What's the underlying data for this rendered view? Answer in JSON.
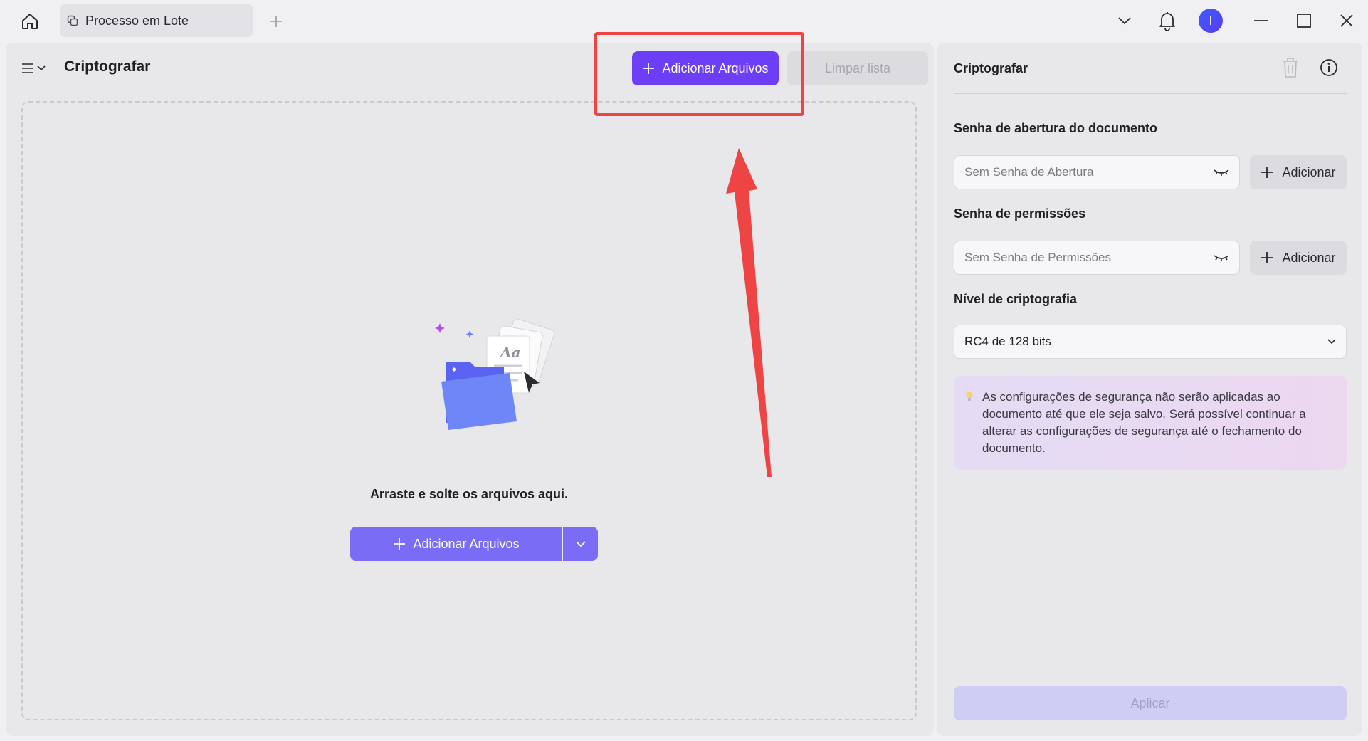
{
  "titlebar": {
    "tab_label": "Processo em Lote",
    "avatar_initial": "I"
  },
  "left": {
    "title": "Criptografar",
    "add_files_label": "Adicionar Arquivos",
    "clear_list_label": "Limpar lista",
    "drop_text": "Arraste e solte os arquivos aqui.",
    "drop_add_files_label": "Adicionar Arquivos"
  },
  "right": {
    "title": "Criptografar",
    "open_password_section": "Senha de abertura do documento",
    "open_password_placeholder": "Sem Senha de Abertura",
    "open_password_add": "Adicionar",
    "permissions_section": "Senha de permissões",
    "permissions_placeholder": "Sem Senha de Permissões",
    "permissions_add": "Adicionar",
    "level_section": "Nível de criptografia",
    "level_value": "RC4 de 128 bits",
    "notice": "As configurações de segurança não serão aplicadas ao documento até que ele seja salvo. Será possível continuar a alterar as configurações de segurança até o fechamento do documento.",
    "apply_label": "Aplicar"
  },
  "colors": {
    "accent": "#6c3ef5",
    "annotation": "#ee4444"
  }
}
